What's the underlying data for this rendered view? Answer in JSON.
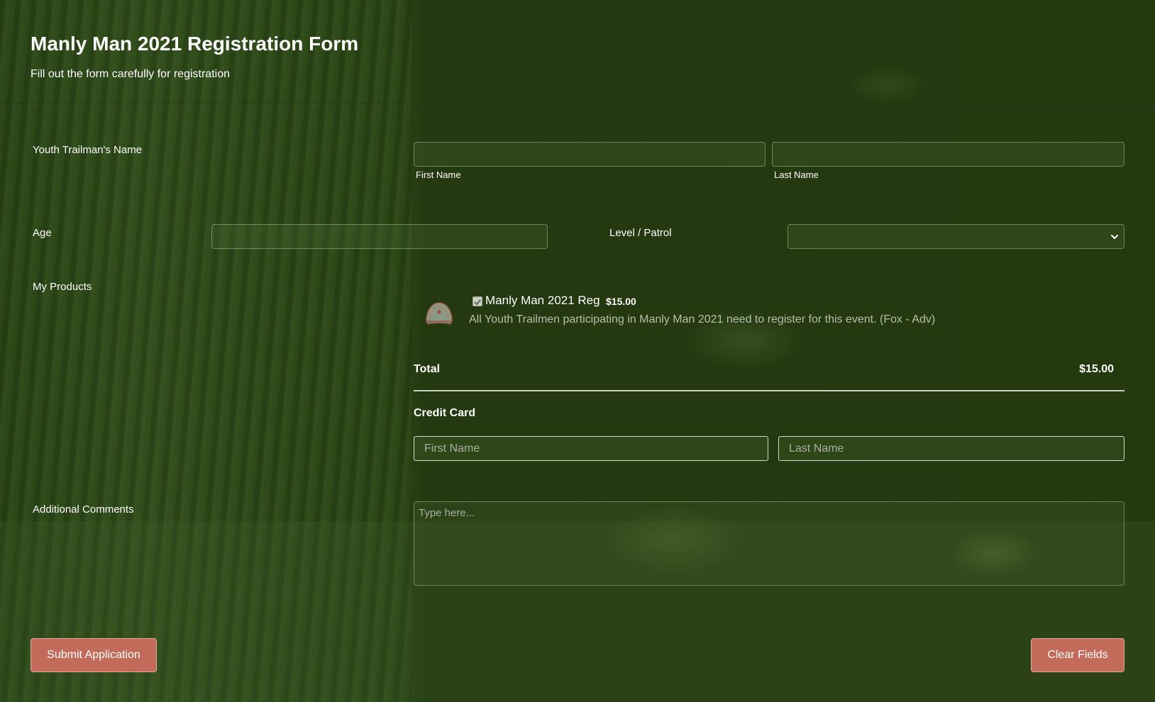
{
  "header": {
    "title": "Manly Man 2021 Registration Form",
    "subtitle": "Fill out the form carefully for registration"
  },
  "name_field": {
    "label": "Youth Trailman's Name",
    "first_sublabel": "First Name",
    "last_sublabel": "Last Name",
    "first_value": "",
    "last_value": ""
  },
  "age_field": {
    "label": "Age",
    "value": ""
  },
  "level_field": {
    "label": "Level / Patrol",
    "selected": ""
  },
  "products": {
    "label": "My Products",
    "items": [
      {
        "name": "Manly Man 2021 Reg",
        "price": "$15.00",
        "description": "All Youth Trailmen participating in Manly Man 2021 need to register for this event. (Fox - Adv)",
        "checked": true,
        "icon": "cap-icon"
      }
    ],
    "total_label": "Total",
    "total_value": "$15.00"
  },
  "credit_card": {
    "label": "Credit Card",
    "first_placeholder": "First Name",
    "last_placeholder": "Last Name"
  },
  "comments": {
    "label": "Additional Comments",
    "placeholder": "Type here..."
  },
  "buttons": {
    "submit": "Submit Application",
    "clear": "Clear Fields"
  },
  "colors": {
    "background": "#25390f",
    "button": "#c26b5a",
    "text": "#ffffff"
  }
}
